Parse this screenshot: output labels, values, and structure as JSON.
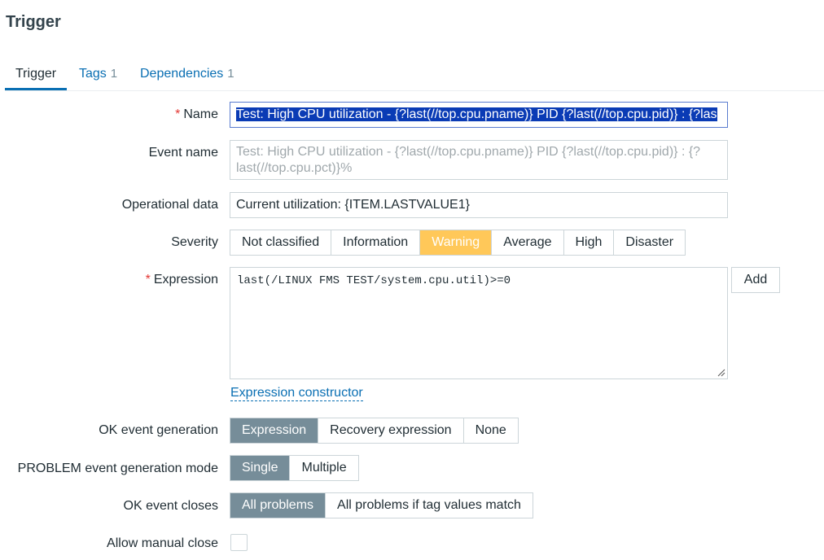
{
  "page": {
    "title": "Trigger"
  },
  "tabs": [
    {
      "label": "Trigger",
      "count": ""
    },
    {
      "label": "Tags",
      "count": "1"
    },
    {
      "label": "Dependencies",
      "count": "1"
    }
  ],
  "form": {
    "name": {
      "label": "Name",
      "value": "Test: High CPU utilization - {?last(//top.cpu.pname)} PID {?last(//top.cpu.pid)} : {?las"
    },
    "event_name": {
      "label": "Event name",
      "placeholder": "Test: High CPU utilization - {?last(//top.cpu.pname)} PID {?last(//top.cpu.pid)} : {?last(//top.cpu.pct)}%"
    },
    "operational_data": {
      "label": "Operational data",
      "value": "Current utilization: {ITEM.LASTVALUE1}"
    },
    "severity": {
      "label": "Severity",
      "options": [
        "Not classified",
        "Information",
        "Warning",
        "Average",
        "High",
        "Disaster"
      ],
      "selected": "Warning",
      "selected_color": "#ffc859"
    },
    "expression": {
      "label": "Expression",
      "value": "last(/LINUX FMS TEST/system.cpu.util)>=0",
      "add_label": "Add",
      "constructor_link": "Expression constructor"
    },
    "ok_event_generation": {
      "label": "OK event generation",
      "options": [
        "Expression",
        "Recovery expression",
        "None"
      ],
      "selected": "Expression"
    },
    "problem_mode": {
      "label": "PROBLEM event generation mode",
      "options": [
        "Single",
        "Multiple"
      ],
      "selected": "Single"
    },
    "ok_event_closes": {
      "label": "OK event closes",
      "options": [
        "All problems",
        "All problems if tag values match"
      ],
      "selected": "All problems"
    },
    "allow_manual_close": {
      "label": "Allow manual close",
      "checked": false
    }
  },
  "colors": {
    "link": "#0a6fb3",
    "required": "#e33734",
    "segment_on": "#768d99"
  }
}
